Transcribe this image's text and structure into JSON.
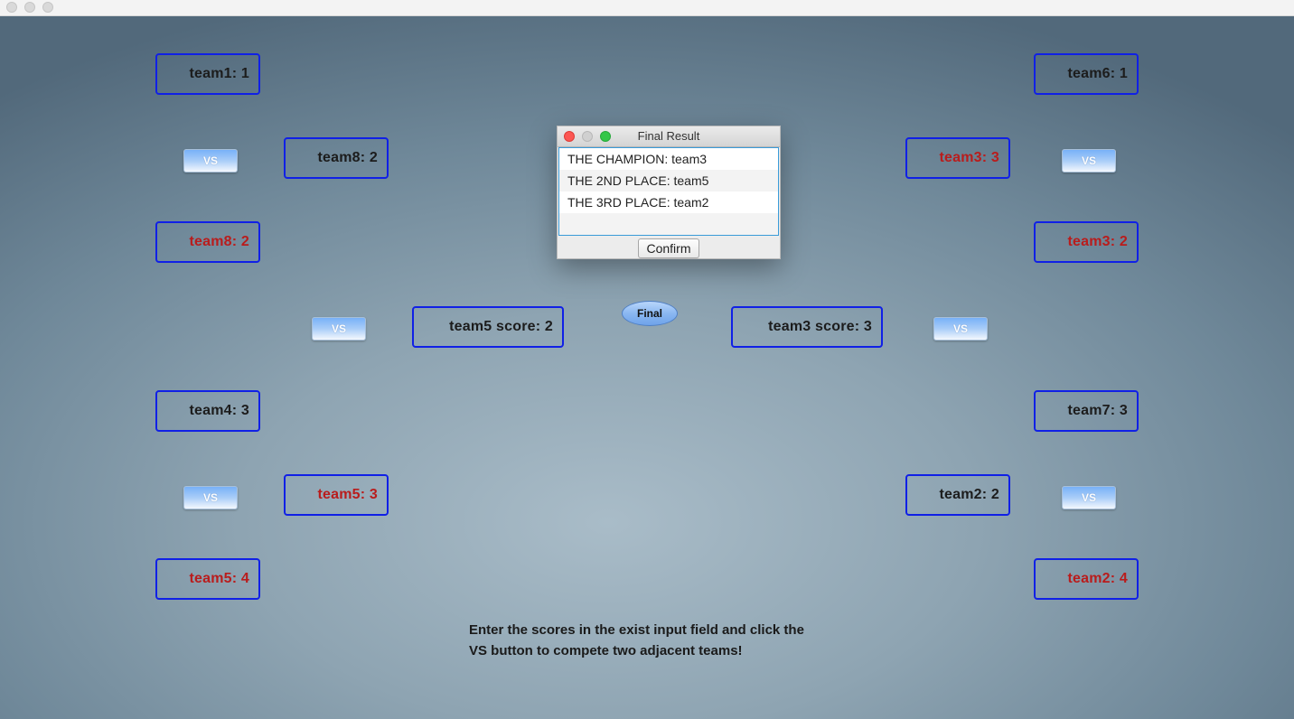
{
  "window": {
    "traffic_lights": [
      "close",
      "minimize",
      "zoom"
    ]
  },
  "bracket": {
    "left": {
      "round1": [
        {
          "label": "team1: 1",
          "winner": false
        },
        {
          "label": "team8: 2",
          "winner": true
        },
        {
          "label": "team4: 3",
          "winner": false
        },
        {
          "label": "team5: 4",
          "winner": true
        }
      ],
      "round2": [
        {
          "label": "team8: 2",
          "winner": false
        },
        {
          "label": "team5: 3",
          "winner": true
        }
      ],
      "semifinal": {
        "label": "team5 score: 2",
        "winner": false
      }
    },
    "right": {
      "round1": [
        {
          "label": "team6: 1",
          "winner": false
        },
        {
          "label": "team3: 2",
          "winner": true
        },
        {
          "label": "team7: 3",
          "winner": false
        },
        {
          "label": "team2: 4",
          "winner": true
        }
      ],
      "round2": [
        {
          "label": "team3: 3",
          "winner": true
        },
        {
          "label": "team2: 2",
          "winner": false
        }
      ],
      "semifinal": {
        "label": "team3 score: 3",
        "winner": false
      }
    },
    "vs_label": "VS",
    "final_label": "Final"
  },
  "dialog": {
    "title": "Final Result",
    "results": [
      "THE CHAMPION: team3",
      "THE 2ND PLACE: team5",
      "THE 3RD PLACE: team2"
    ],
    "confirm_label": "Confirm"
  },
  "instructions": "Enter the scores in the exist input field and click the VS button to compete two adjacent teams!",
  "colors": {
    "team_border": "#1020e6",
    "winner_text": "#b91c1c",
    "normal_text": "#1c1c1c"
  }
}
